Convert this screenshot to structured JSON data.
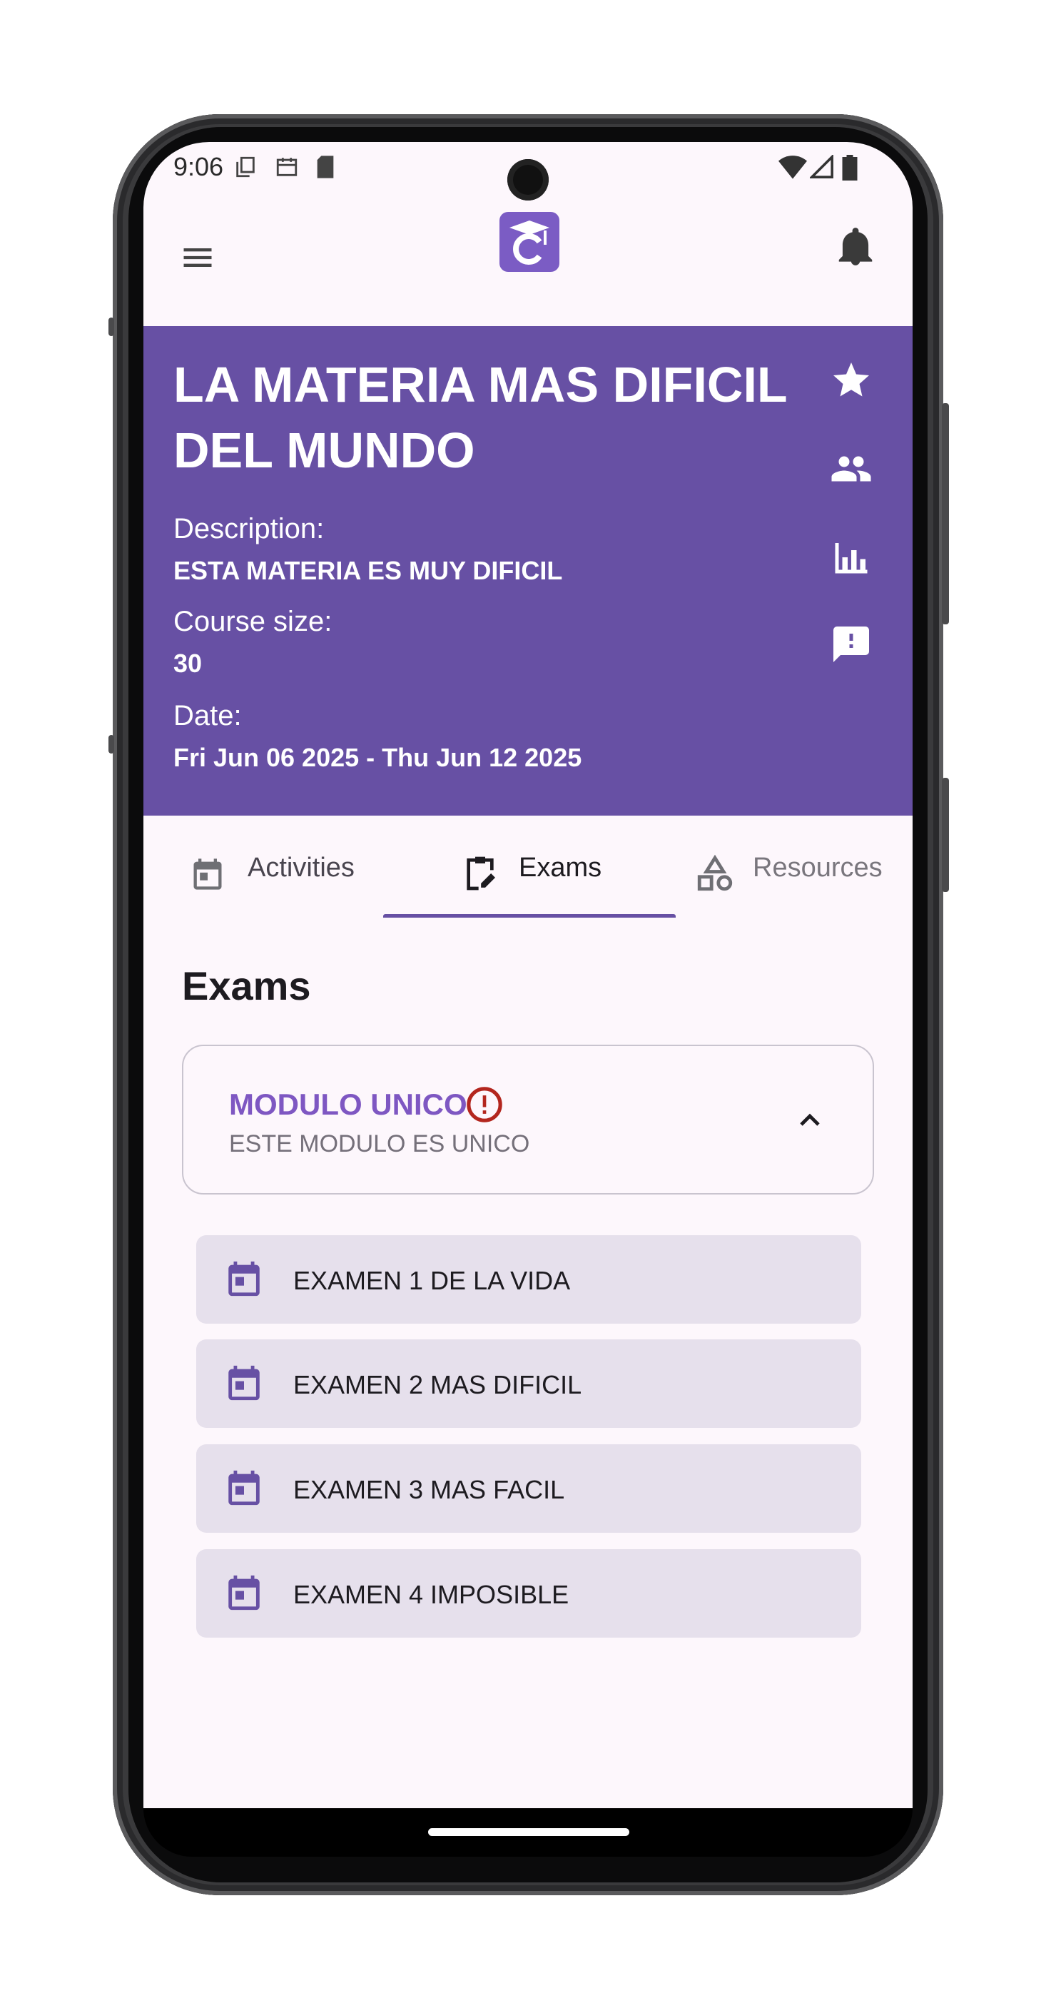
{
  "status_bar": {
    "time": "9:06"
  },
  "app_bar": {
    "logo_letter": "C"
  },
  "course": {
    "title": "LA MATERIA MAS DIFICIL DEL MUNDO",
    "description_label": "Description:",
    "description": "ESTA MATERIA ES MUY DIFICIL",
    "size_label": "Course size:",
    "size": "30",
    "date_label": "Date:",
    "date": "Fri Jun 06 2025 - Thu Jun 12 2025"
  },
  "tabs": [
    {
      "label": "Activities",
      "icon": "calendar-icon",
      "selected": false
    },
    {
      "label": "Exams",
      "icon": "clipboard-edit-icon",
      "selected": true
    },
    {
      "label": "Resources",
      "icon": "shapes-icon",
      "selected": false
    }
  ],
  "section": {
    "title": "Exams"
  },
  "module": {
    "title": "MODULO UNICO",
    "subtitle": "ESTE MODULO ES UNICO",
    "expanded": true
  },
  "exams": [
    {
      "label": "EXAMEN 1 DE LA VIDA"
    },
    {
      "label": "EXAMEN 2 MAS DIFICIL"
    },
    {
      "label": "EXAMEN 3 MAS FACIL"
    },
    {
      "label": "EXAMEN 4 IMPOSIBLE"
    }
  ],
  "colors": {
    "primary": "#6750a4",
    "module_title": "#7e57c2",
    "alert": "#b3261e",
    "exam_item_bg": "#e6e0ec",
    "background": "#fdf7fc"
  }
}
